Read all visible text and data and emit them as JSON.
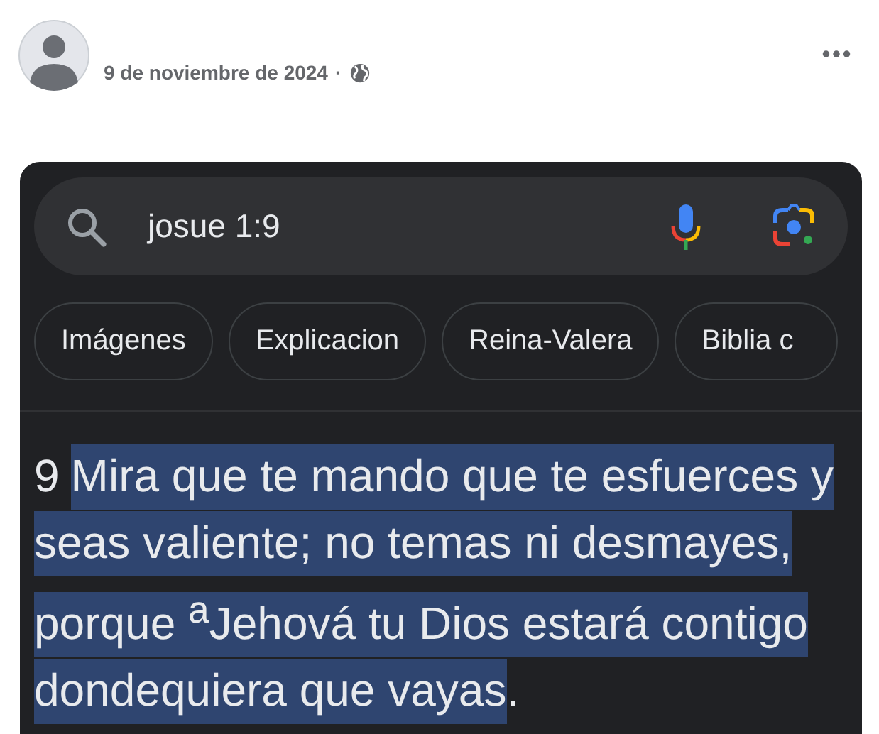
{
  "post": {
    "date": "9 de noviembre de 2024",
    "separator": "·"
  },
  "search": {
    "value": "josue 1:9"
  },
  "chips": [
    {
      "label": "Imágenes"
    },
    {
      "label": "Explicacion"
    },
    {
      "label": "Reina-Valera"
    },
    {
      "label": "Biblia c"
    }
  ],
  "verse": {
    "number": "9",
    "text": "Mira que te mando que te esfuerces y seas valiente; no temas ni desmayes, porque $^{a}$Jehová tu Dios estará contigo dondequiera que vayas",
    "highlighted": true,
    "end": "."
  }
}
